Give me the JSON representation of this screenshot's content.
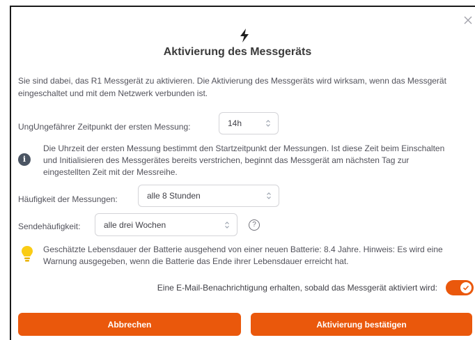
{
  "dialog": {
    "title": "Aktivierung des Messgeräts",
    "close_icon": "close-icon",
    "header_icon": "lightning-bolt-icon",
    "intro": "Sie sind dabei, das R1 Messgerät zu aktivieren. Die Aktivierung des Messgeräts wird wirksam, wenn das Messgerät eingeschaltet und mit dem Netzwerk verbunden ist."
  },
  "first_measurement": {
    "label": "UngUngefährer Zeitpunkt der ersten Messung:",
    "value": "14h"
  },
  "info": {
    "icon": "info-icon",
    "text": "Die Uhrzeit der ersten Messung bestimmt den Startzeitpunkt der Messungen. Ist diese Zeit beim Einschalten und Initialisieren des Messgerätes bereits verstrichen, beginnt das Messgerät am nächsten Tag zur eingestellten Zeit mit der Messreihe."
  },
  "frequency": {
    "label": "Häufigkeit der Messungen:",
    "value": "alle 8 Stunden"
  },
  "send_frequency": {
    "label": "Sendehäufigkeit:",
    "value": "alle drei Wochen",
    "help_icon": "question-circle-icon",
    "help_glyph": "?"
  },
  "battery": {
    "icon": "lightbulb-icon",
    "text": "Geschätzte Lebensdauer der Batterie ausgehend von einer neuen Batterie: 8.4 Jahre. Hinweis: Es wird eine Warnung ausgegeben, wenn die Batterie das Ende ihrer Lebensdauer erreicht hat."
  },
  "email_notification": {
    "label": "Eine E-Mail-Benachrichtigung erhalten, sobald das Messgerät aktiviert wird:",
    "enabled": true
  },
  "buttons": {
    "cancel": "Abbrechen",
    "confirm": "Aktivierung bestätigen"
  },
  "colors": {
    "accent": "#ea580c",
    "info_icon": "#4b5563",
    "bulb": "#facc15"
  }
}
